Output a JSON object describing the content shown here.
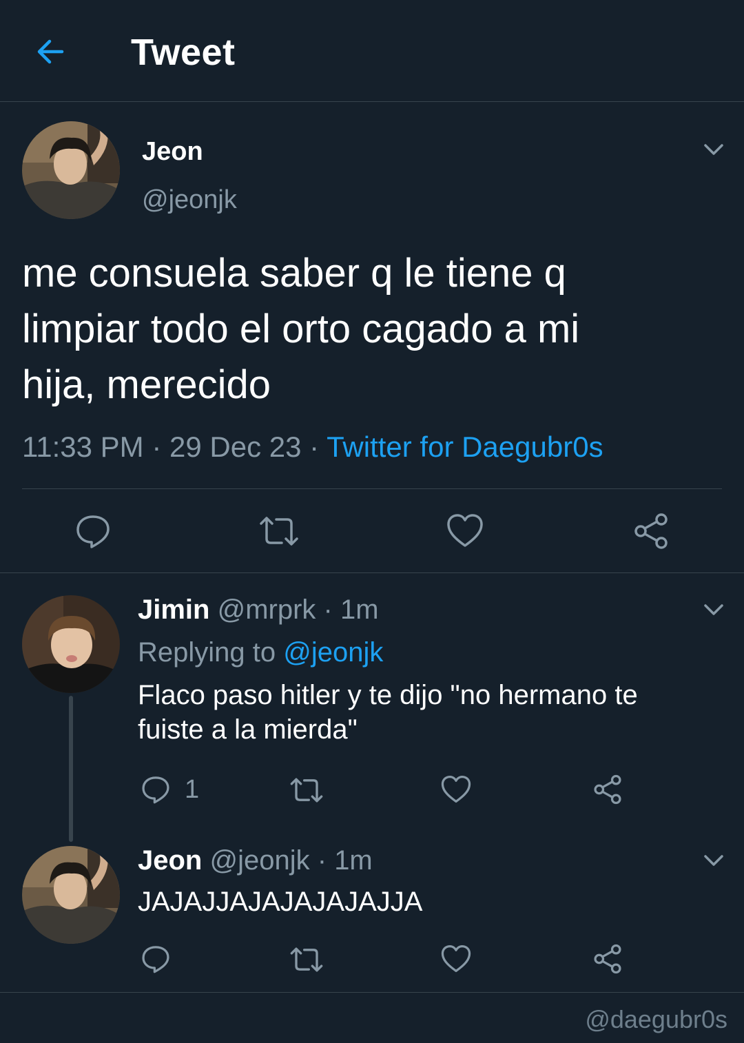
{
  "header": {
    "title": "Tweet",
    "back_icon": "arrow-left-icon",
    "accent_color": "#1da1f2"
  },
  "main_tweet": {
    "name": "Jeon",
    "handle": "@jeonjk",
    "text": "me consuela saber q le tiene q\nlimpiar todo el orto cagado a mi\nhija, merecido",
    "time": "11:33 PM",
    "date": "29 Dec 23",
    "separator": "·",
    "source": "Twitter for Daegubr0s",
    "actions": [
      "reply-icon",
      "retweet-icon",
      "like-icon",
      "share-icon"
    ]
  },
  "replies": [
    {
      "name": "Jimin",
      "handle": "@mrprk",
      "time": "1m",
      "separator": "·",
      "replying_to_label": "Replying to",
      "replying_to_handle": "@jeonjk",
      "text": "Flaco paso hitler y te dijo \"no hermano te fuiste a la mierda\"",
      "reply_count": "1"
    },
    {
      "name": "Jeon",
      "handle": "@jeonjk",
      "time": "1m",
      "separator": "·",
      "text": "JAJAJJAJAJAJAJAJJA"
    }
  ],
  "watermark": "@daegubr0s",
  "colors": {
    "background": "#15202b",
    "border": "#38444d",
    "muted_text": "#8899a6"
  }
}
